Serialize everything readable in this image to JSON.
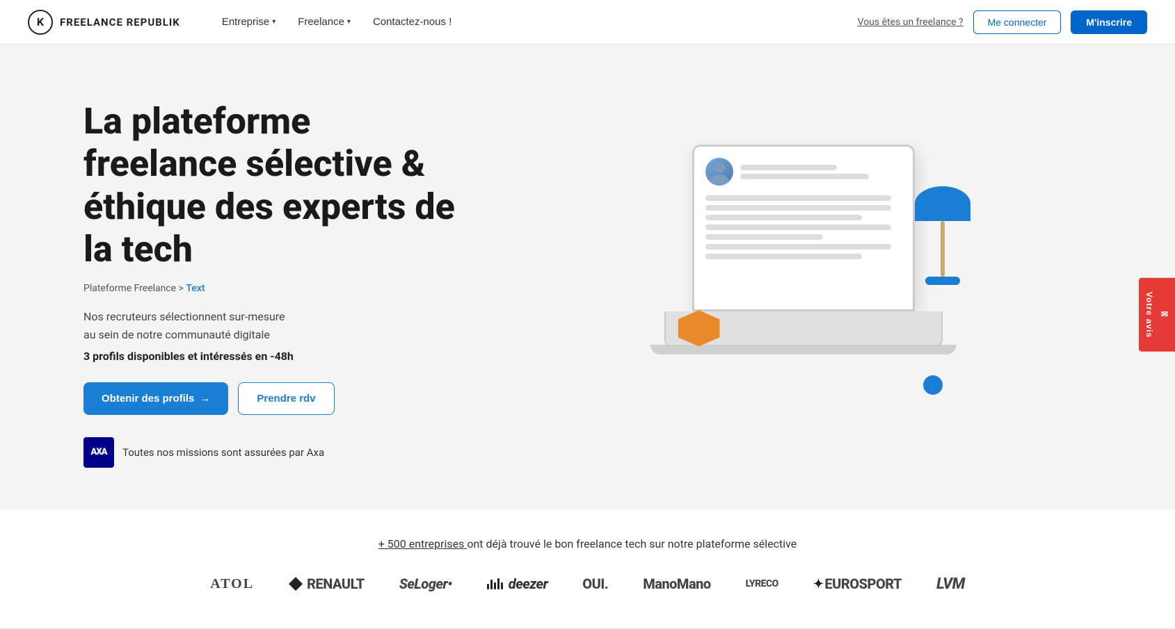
{
  "nav": {
    "logo_letter": "K",
    "logo_name": "FREELANCE REPUBLIK",
    "links": [
      {
        "label": "Entreprise",
        "has_dropdown": true
      },
      {
        "label": "Freelance",
        "has_dropdown": true
      },
      {
        "label": "Contactez-nous !",
        "has_dropdown": false
      }
    ],
    "freelance_link": "Vous êtes un freelance ?",
    "login_label": "Me connecter",
    "signup_label": "M'inscrire"
  },
  "hero": {
    "title": "La plateforme freelance sélective & éthique des experts de la tech",
    "breadcrumb_base": "Plateforme Freelance",
    "breadcrumb_separator": ">",
    "breadcrumb_current": "Text",
    "description_line1": "Nos recruteurs sélectionnent sur-mesure",
    "description_line2": "au sein de notre communauté digitale",
    "highlight": "3 profils disponibles et intéressés en -48h",
    "btn_profils": "Obtenir des profils",
    "btn_rdv": "Prendre rdv",
    "assurance_text": "Toutes nos missions sont assurées par Axa",
    "axa_label": "AXA"
  },
  "feedback": {
    "label": "Votre avis"
  },
  "companies": {
    "tagline_prefix": "+ 500 entreprises",
    "tagline_suffix": " ont déjà trouvé le bon freelance tech sur notre plateforme sélective",
    "logos": [
      {
        "name": "atol",
        "display": "ATOL"
      },
      {
        "name": "renault",
        "display": "RENAULT"
      },
      {
        "name": "seloger",
        "display": "SeLoger•"
      },
      {
        "name": "deezer",
        "display": "deezer"
      },
      {
        "name": "oui",
        "display": "OUI."
      },
      {
        "name": "manomano",
        "display": "ManoMano"
      },
      {
        "name": "lyreco",
        "display": "LYRECO"
      },
      {
        "name": "eurosport",
        "display": "EUROSPORT"
      },
      {
        "name": "lvm",
        "display": "LVM"
      }
    ]
  }
}
